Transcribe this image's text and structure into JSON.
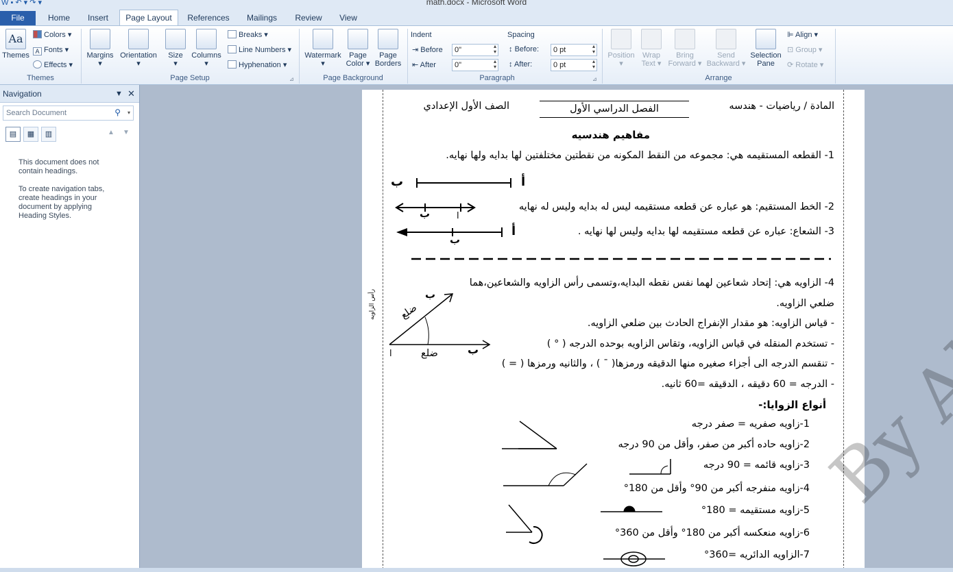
{
  "title": "math.docx - Microsoft Word",
  "tabs": [
    "File",
    "Home",
    "Insert",
    "Page Layout",
    "References",
    "Mailings",
    "Review",
    "View"
  ],
  "ribbon": {
    "themes": {
      "themes": "Themes",
      "colors": "Colors",
      "fonts": "Fonts",
      "effects": "Effects",
      "group": "Themes"
    },
    "page_setup": {
      "margins": "Margins",
      "orientation": "Orientation",
      "size": "Size",
      "columns": "Columns",
      "breaks": "Breaks",
      "line_numbers": "Line Numbers",
      "hyphenation": "Hyphenation",
      "group": "Page Setup"
    },
    "page_background": {
      "watermark": "Watermark",
      "page_color_1": "Page",
      "page_color_2": "Color",
      "page_borders_1": "Page",
      "page_borders_2": "Borders",
      "group": "Page Background"
    },
    "paragraph": {
      "indent": "Indent",
      "before": "Before",
      "after": "After",
      "indent_before": "0\"",
      "indent_after": "0\"",
      "spacing": "Spacing",
      "sp_before": "Before:",
      "sp_after": "After:",
      "sp_before_val": "0 pt",
      "sp_after_val": "0 pt",
      "group": "Paragraph"
    },
    "arrange": {
      "position": "Position",
      "wrap_1": "Wrap",
      "wrap_2": "Text",
      "bring_1": "Bring",
      "bring_2": "Forward",
      "send_1": "Send",
      "send_2": "Backward",
      "selection_1": "Selection",
      "selection_2": "Pane",
      "align": "Align",
      "group_btn": "Group",
      "rotate": "Rotate",
      "group": "Arrange"
    }
  },
  "nav": {
    "title": "Navigation",
    "search_placeholder": "Search Document",
    "msg1": "This document does not contain headings.",
    "msg2": "To create navigation tabs, create headings in your document by applying Heading Styles."
  },
  "doc": {
    "subject": "المادة / رياضيات - هندسه",
    "term": "الفصل الدراسي الأول",
    "grade": "الصف الأول الإعدادي",
    "heading": "مفاهيم هندسيه",
    "l1": "1- القطعه المستقيمه هي: مجموعه من النقط المكونه من نقطتين مختلفتين لها بدايه ولها نهايه.",
    "l2": "2- الخط المستقيم: هو عباره عن قطعه مستقيمه ليس له بدايه وليس له نهايه",
    "l3": "3- الشعاع: عباره عن قطعه مستقيمه لها بدايه وليس لها نهايه .",
    "l4a": "4- الزاويه هي: إتحاد شعاعين لهما نفس نقطه البدايه،وتسمى رأس الزاويه والشعاعين،هما",
    "l4b": "ضلعي الزاويه.",
    "b1": "- قياس الزاويه: هو مقدار الإنفراج الحادث بين ضلعي الزاويه.",
    "b2": "- تستخدم المنقله في قياس الزاويه، وتقاس الزاويه بوحده الدرجه ( ° )",
    "b3": "- تنقسم الدرجه الى أجزاء صغيره منها الدقيقه ورمزها( ¯ ) ، والثانيه ورمزها ( = )",
    "b4": "- الدرجه = 60 دقيقه ، الدقيقه =60 ثانيه.",
    "types": "أنواع الزوايا:-",
    "t1": "1-زاويه صفريه = صفر درجه",
    "t2": "2-زاويه حاده أكبر من صفر، وأقل من 90 درجه",
    "t3": "3-زاويه قائمه = 90 درجه",
    "t4": "4-زاويه منفرجه أكبر من 90° وأقل من 180°",
    "t5": "5-زاويه مستقيمه = 180°",
    "t6": "6-زاويه منعكسه أكبر من 180° وأقل من 360°",
    "t7": "7-الزاويه الدائريه =360°",
    "pt_a": "أ",
    "pt_b": "ب",
    "pt_a2": "ا",
    "side": "ضلع",
    "vertex": "رأس الزاويه",
    "watermark": "By Ahmad Gamal"
  }
}
